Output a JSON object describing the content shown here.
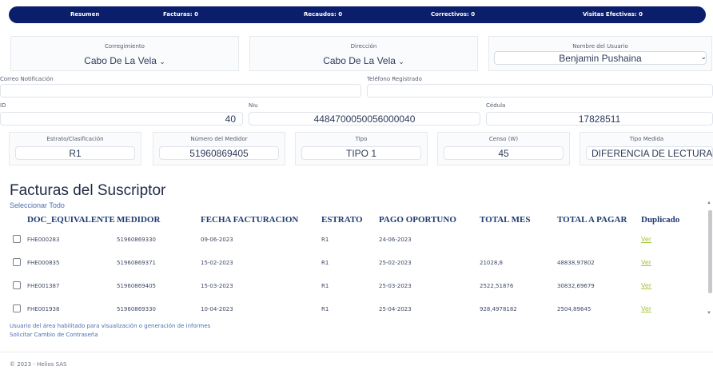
{
  "summary_bar": {
    "resumen": "Resumen",
    "facturas": "Facturas: 0",
    "recaudos": "Recaudos: 0",
    "correctivos": "Correctivos: 0",
    "visitas": "Visitas Efectivas: 0"
  },
  "selectors": {
    "corregimiento": {
      "label": "Corregimiento",
      "value": "Cabo De La Vela"
    },
    "direccion": {
      "label": "Dirección",
      "value": "Cabo De La Vela"
    },
    "usuario": {
      "label": "Nombre del Usuario",
      "value": "Benjamin Pushaina"
    }
  },
  "contact": {
    "correo_label": "Correo Notificación",
    "correo_value": "",
    "telefono_label": "Teléfono Registrado",
    "telefono_value": ""
  },
  "ids": {
    "id_label": "ID",
    "id_value": "40",
    "niu_label": "Niu",
    "niu_value": "4484700050056000040",
    "cedula_label": "Cédula",
    "cedula_value": "17828511"
  },
  "meter": {
    "estrato_label": "Estrato/Clasificación",
    "estrato_value": "R1",
    "medidor_label": "Número del Medidor",
    "medidor_value": "51960869405",
    "tipo_label": "Tipo",
    "tipo_value": "TIPO 1",
    "censo_label": "Censo (W)",
    "censo_value": "45",
    "tipo_medida_label": "Tipo Medida",
    "tipo_medida_value": "DIFERENCIA DE LECTURA"
  },
  "invoices": {
    "title": "Facturas del Suscriptor",
    "select_all": "Seleccionar Todo",
    "headers": [
      "DOC_EQUIVALENTE",
      "MEDIDOR",
      "FECHA FACTURACION",
      "ESTRATO",
      "PAGO OPORTUNO",
      "TOTAL MES",
      "TOTAL A PAGAR",
      "Duplicado"
    ],
    "rows": [
      [
        "FHE000283",
        "51960869330",
        "09-06-2023",
        "R1",
        "24-06-2023",
        "",
        "",
        "Ver"
      ],
      [
        "FHE000835",
        "51960869371",
        "15-02-2023",
        "R1",
        "25-02-2023",
        "21028,8",
        "48838,97802",
        "Ver"
      ],
      [
        "FHE001387",
        "51960869405",
        "15-03-2023",
        "R1",
        "25-03-2023",
        "2522,51876",
        "30832,69679",
        "Ver"
      ],
      [
        "FHE001938",
        "51960869330",
        "10-04-2023",
        "R1",
        "25-04-2023",
        "928,4978182",
        "2504,89645",
        "Ver"
      ]
    ]
  },
  "footer": {
    "notice": "Usuario del área habilitado para visualización o generación de informes",
    "change_password": "Solicitar Cambio de Contraseña",
    "copyright": "© 2023 - Helios SAS"
  }
}
